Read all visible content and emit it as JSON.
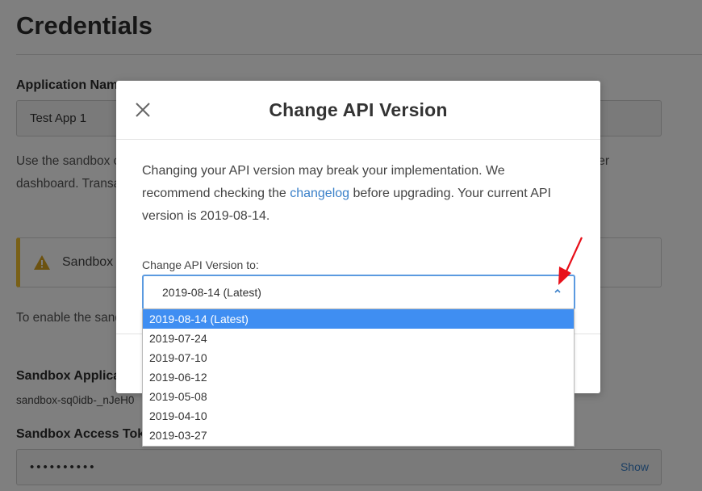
{
  "page": {
    "title": "Credentials",
    "app_name_label": "Application Name",
    "app_name_value": "Test App 1",
    "sandbox_text": "Use the sandbox credentials to test your application with the sandbox endpoints and connect with the seller dashboard. Transactions in the sandbox are not real.",
    "warning_text": "Sandbox",
    "enable_text": "To enable the sandbox, provide the sandbox application ID and application ID. ",
    "sandbox_app_id_label": "Sandbox Application ID",
    "sandbox_app_id_value": "sandbox-sq0idb-_nJeH0",
    "sandbox_token_label": "Sandbox Access Token",
    "sandbox_token_value": "••••••••••",
    "show_label": "Show"
  },
  "modal": {
    "title": "Change API Version",
    "body_part1": "Changing your API version may break your implementation. We recommend checking the ",
    "body_link": "changelog",
    "body_part2": " before upgrading. Your current API version is 2019-08-14.",
    "select_label": "Change API Version to:",
    "selected_value": "2019-08-14 (Latest)"
  },
  "dropdown": {
    "options": [
      "2019-08-14 (Latest)",
      "2019-07-24",
      "2019-07-10",
      "2019-06-12",
      "2019-05-08",
      "2019-04-10",
      "2019-03-27"
    ],
    "selected_index": 0
  },
  "colors": {
    "accent": "#3a80c9",
    "selected_option": "#3f8ef2",
    "warning": "#f2c12e",
    "annotation": "#e8101a"
  }
}
